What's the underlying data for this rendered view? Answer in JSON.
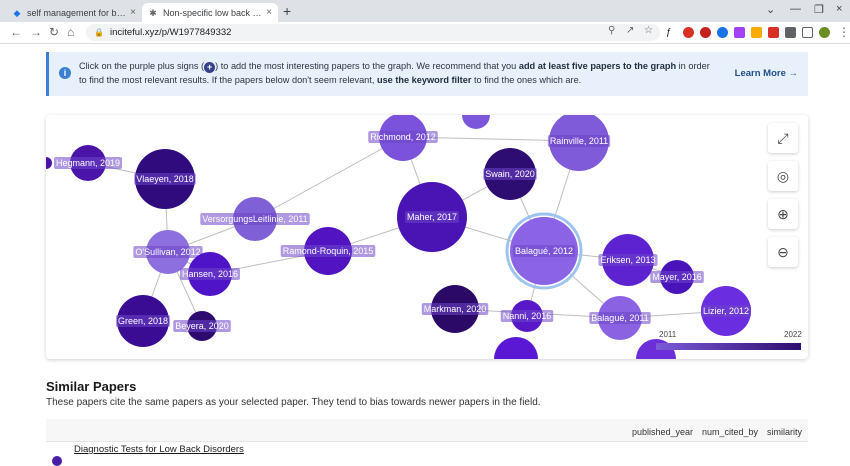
{
  "browser": {
    "tabs": [
      {
        "label": "self management for back pain -",
        "active": false
      },
      {
        "label": "Non-specific low back pain | Incit",
        "active": true
      }
    ],
    "url": "inciteful.xyz/p/W1977849332"
  },
  "banner": {
    "t1": "Click on the purple plus signs (",
    "t2": ") to add the most interesting papers to the graph. We recommend that you ",
    "b1": "add at least five papers to the graph",
    "t3": " in order to find the most relevant results. If the papers below don't seem relevant, ",
    "b2": "use the keyword filter",
    "t4": " to find the ones which are.",
    "learn_more": "Learn More →"
  },
  "graph": {
    "nodes": [
      {
        "label": "Hegmann, 2019"
      },
      {
        "label": "Vlaeyen, 2018"
      },
      {
        "label": "Richmond, 2012"
      },
      {
        "label": "Rainville, 2011"
      },
      {
        "label": "Swain, 2020"
      },
      {
        "label": "VersorgungsLeitlinie, 2011"
      },
      {
        "label": "Maher, 2017"
      },
      {
        "label": "O'Sullivan, 2012"
      },
      {
        "label": "Ramond-Roquin, 2015"
      },
      {
        "label": "Balagué, 2012"
      },
      {
        "label": "Eriksen, 2013"
      },
      {
        "label": "Hansen, 2016"
      },
      {
        "label": "Mayer, 2016"
      },
      {
        "label": "Markman, 2020"
      },
      {
        "label": "Nanni, 2016"
      },
      {
        "label": "Green, 2018"
      },
      {
        "label": "Beyera, 2020"
      },
      {
        "label": "Balagué, 2011"
      },
      {
        "label": "Lizier, 2012"
      }
    ],
    "legend": {
      "min": "2011",
      "max": "2022"
    }
  },
  "similar": {
    "title": "Similar Papers",
    "description": "These papers cite the same papers as your selected paper. They tend to bias towards newer papers in the field.",
    "columns": [
      "published_year",
      "num_cited_by",
      "similarity"
    ],
    "rows": [
      {
        "title": "Diagnostic Tests for Low Back Disorders"
      }
    ]
  }
}
